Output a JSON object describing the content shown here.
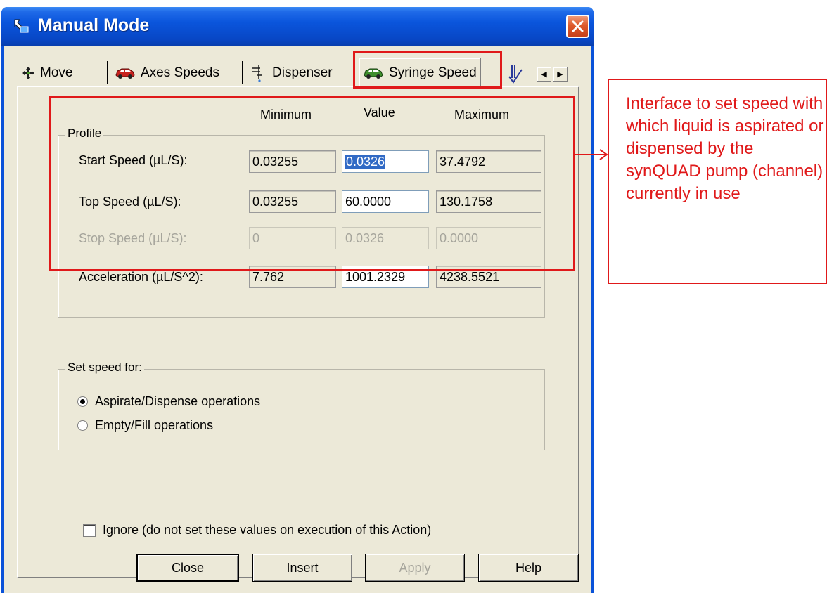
{
  "window": {
    "title": "Manual Mode"
  },
  "tabs": [
    {
      "label": "Move",
      "icon": "move-arrows-icon"
    },
    {
      "label": "Axes Speeds",
      "icon": "red-car-icon"
    },
    {
      "label": "Dispenser",
      "icon": "dispenser-icon"
    },
    {
      "label": "Syringe Speed",
      "icon": "green-car-icon",
      "active": true
    }
  ],
  "profile": {
    "group_title": "Profile",
    "columns": {
      "minimum": "Minimum",
      "value": "Value",
      "maximum": "Maximum"
    },
    "rows": [
      {
        "label": "Start Speed (µL/S):",
        "minimum": "0.03255",
        "value": "0.0326",
        "maximum": "37.4792",
        "enabled": true,
        "value_selected": true
      },
      {
        "label": "Top Speed (µL/S):",
        "minimum": "0.03255",
        "value": "60.0000",
        "maximum": "130.1758",
        "enabled": true
      },
      {
        "label": "Stop Speed (µL/S):",
        "minimum": "0",
        "value": "0.0326",
        "maximum": "0.0000",
        "enabled": false
      },
      {
        "label": "Acceleration (µL/S^2):",
        "minimum": "7.762",
        "value": "1001.2329",
        "maximum": "4238.5521",
        "enabled": true
      }
    ]
  },
  "set_speed": {
    "group_title": "Set speed for:",
    "options": [
      {
        "label": "Aspirate/Dispense operations",
        "selected": true
      },
      {
        "label": "Empty/Fill operations",
        "selected": false
      }
    ]
  },
  "ignore": {
    "label": "Ignore (do not set these values on execution of this Action)",
    "checked": false
  },
  "buttons": {
    "close": "Close",
    "insert": "Insert",
    "apply": "Apply",
    "help": "Help"
  },
  "annotation": {
    "text": "Interface to set speed with which liquid is aspirated or dispensed by the synQUAD pump (channel) currently in use"
  },
  "colors": {
    "highlight": "#e0191a",
    "titlebar": "#0a55dc",
    "dialog_bg": "#ece9d8"
  }
}
